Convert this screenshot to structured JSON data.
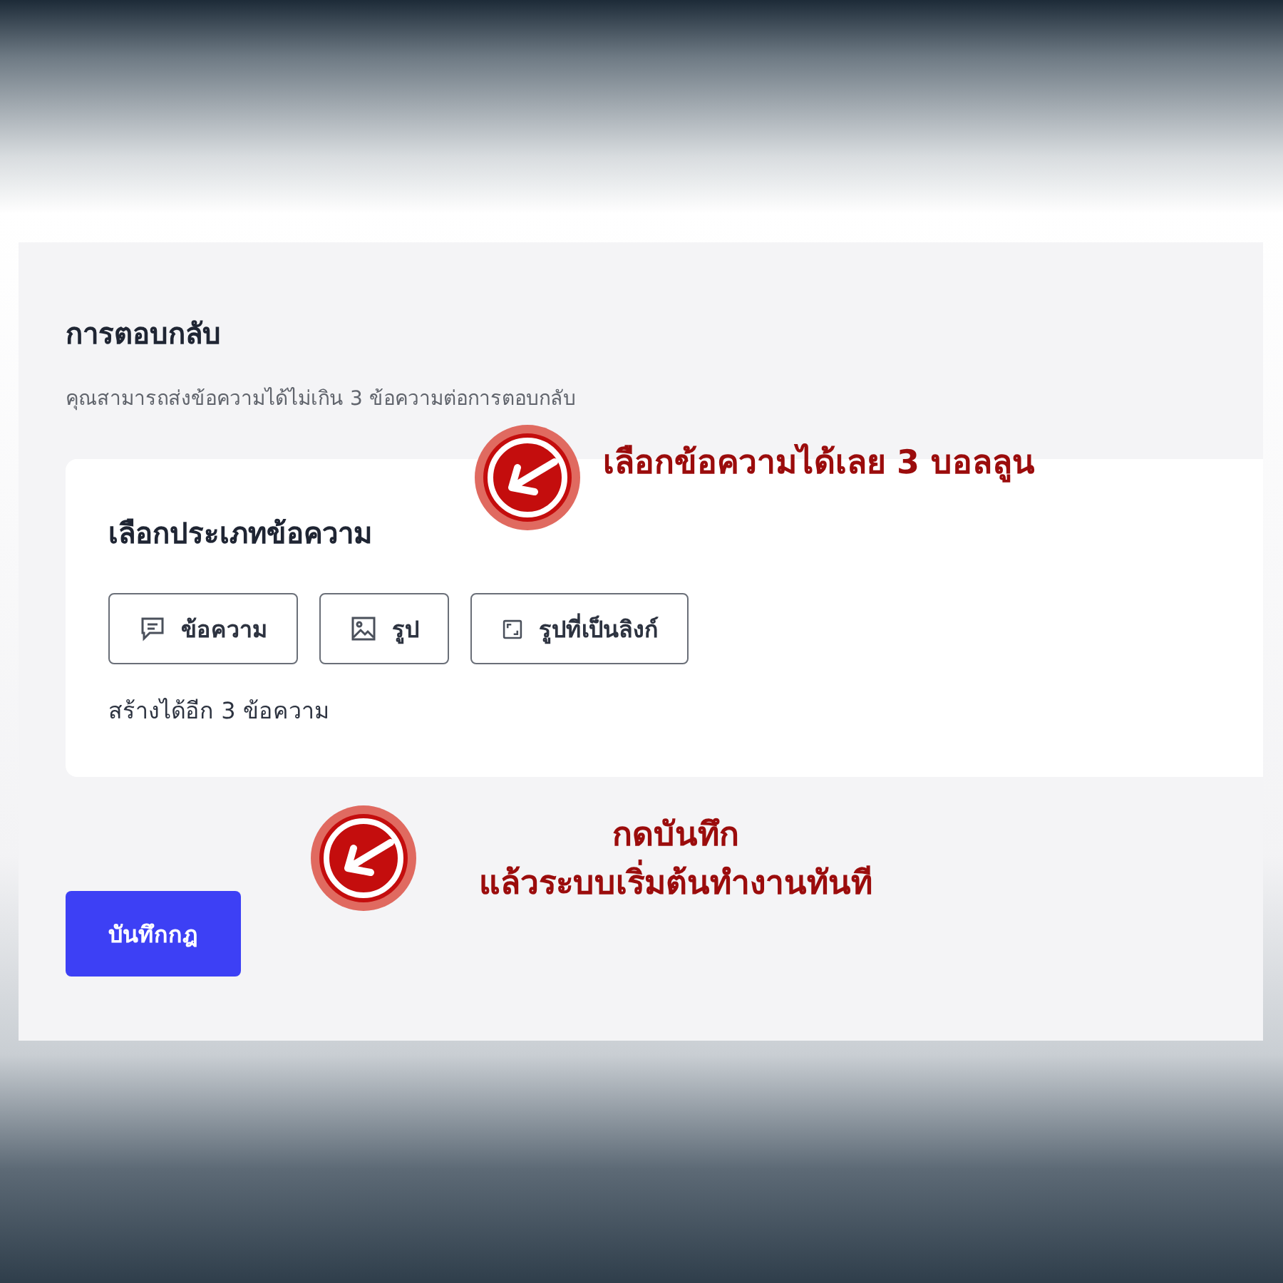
{
  "section": {
    "title": "การตอบกลับ",
    "subtitle": "คุณสามารถส่งข้อความได้ไม่เกิน 3 ข้อความต่อการตอบกลับ"
  },
  "card": {
    "title": "เลือกประเภทข้อความ",
    "buttons": [
      {
        "kind": "message",
        "label": "ข้อความ"
      },
      {
        "kind": "image",
        "label": "รูป"
      },
      {
        "kind": "linked_image",
        "label": "รูปที่เป็นลิงก์"
      }
    ],
    "note": "สร้างได้อีก 3 ข้อความ"
  },
  "save_button": {
    "label": "บันทึกกฎ"
  },
  "callouts": [
    {
      "lines": [
        "เลือกข้อความได้เลย 3 บอลลูน"
      ]
    },
    {
      "lines": [
        "กดบันทึก",
        "แล้วระบบเริ่มต้นทำงานทันที"
      ]
    }
  ]
}
